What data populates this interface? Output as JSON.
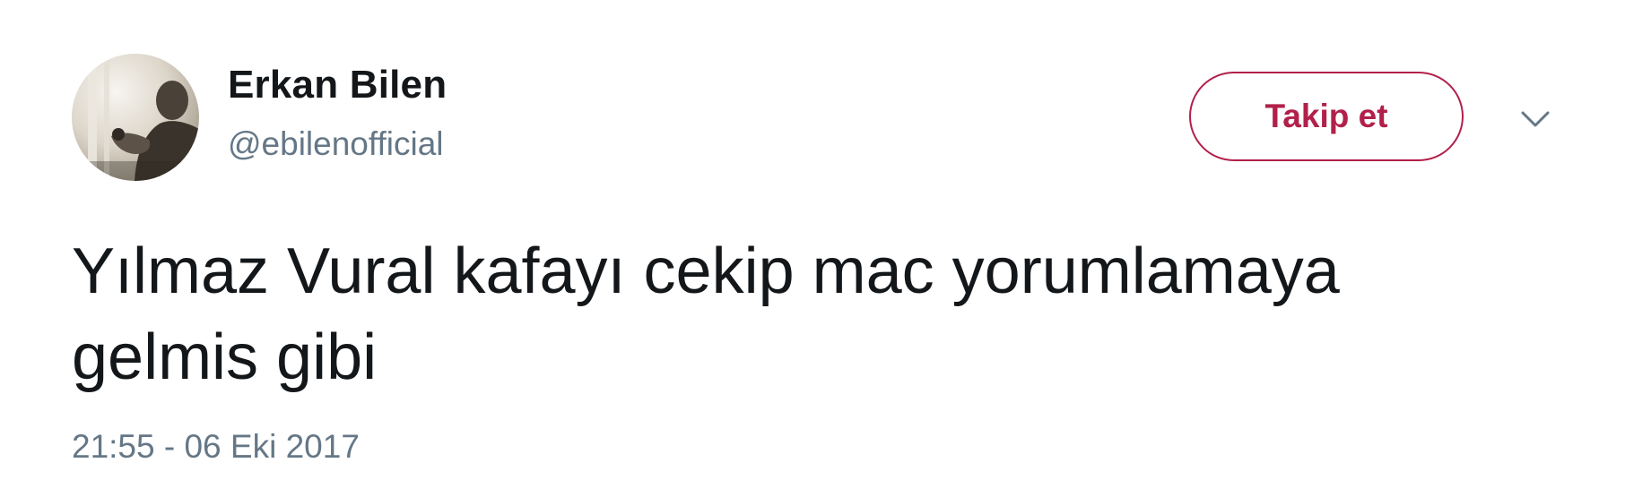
{
  "tweet": {
    "author": {
      "display_name": "Erkan Bilen",
      "screen_name": "@ebilenofficial",
      "avatar_icon": "profile-photo"
    },
    "follow_button": {
      "label": "Takip et",
      "color": "#b2204a"
    },
    "menu_icon": "chevron-down-icon",
    "text_line_1": "Yılmaz Vural kafayı cekip mac yorumlamaya",
    "text_line_2": "gelmis gibi",
    "timestamp": "21:55 - 06 Eki 2017"
  }
}
